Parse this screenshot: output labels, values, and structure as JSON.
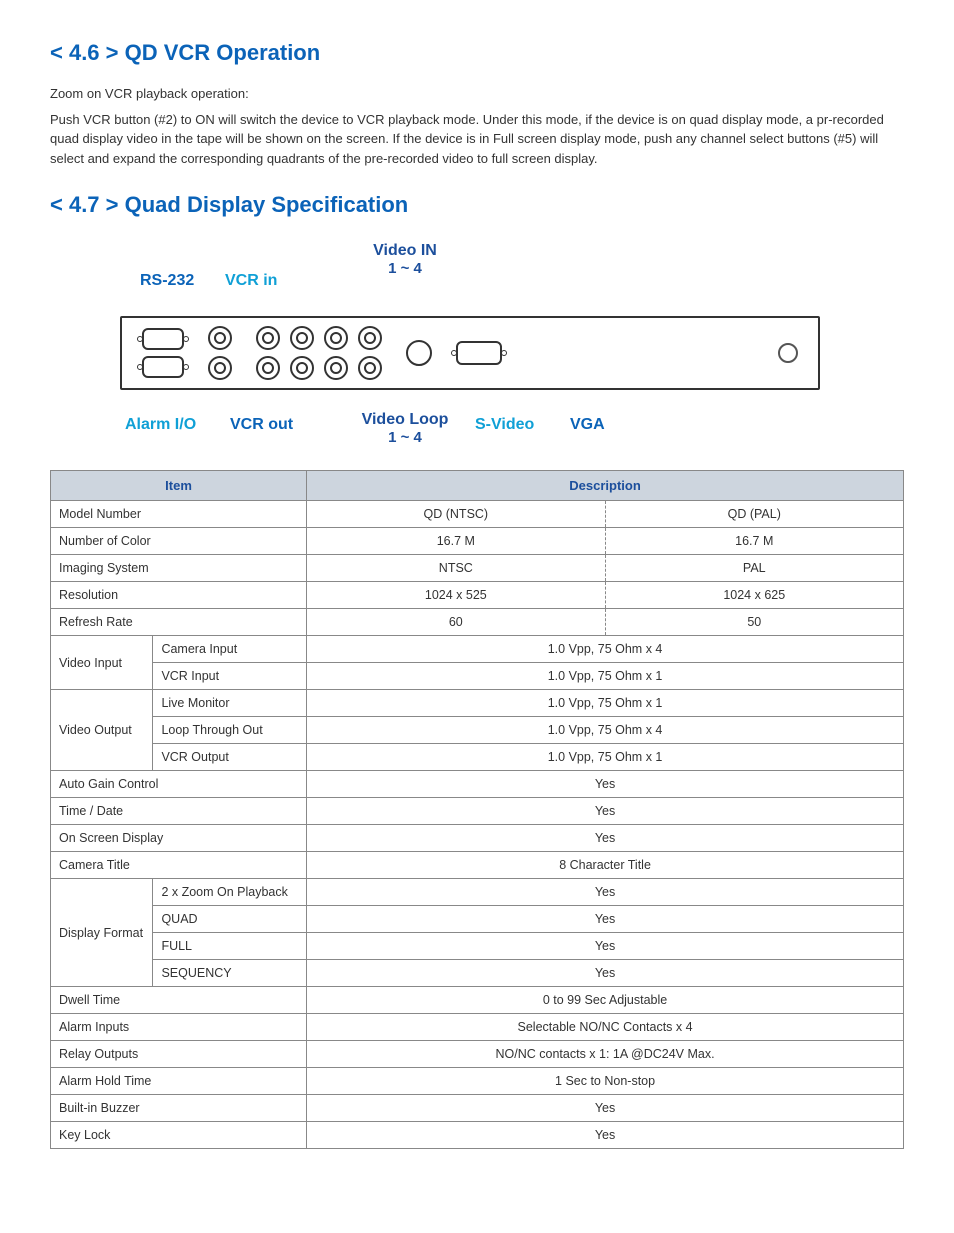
{
  "section46": {
    "title": "< 4.6 > QD  VCR Operation",
    "intro": "Zoom on VCR playback operation:",
    "body": "Push VCR button (#2) to ON will switch the device to VCR playback mode. Under this mode, if the device is on quad display mode, a pr-recorded quad display video in the tape will be shown on the screen. If the device is in Full screen display mode, push any channel select buttons (#5) will select and expand the corresponding quadrants of the pre-recorded video to full screen display."
  },
  "section47": {
    "title": "< 4.7 > Quad Display Specification"
  },
  "diagram": {
    "rs232": "RS-232",
    "vcr_in": "VCR in",
    "video_in": "Video IN",
    "video_in_range": "1 ~ 4",
    "alarm_io": "Alarm I/O",
    "vcr_out": "VCR out",
    "video_loop": "Video Loop",
    "video_loop_range": "1 ~ 4",
    "s_video": "S-Video",
    "vga": "VGA"
  },
  "table": {
    "header_item": "Item",
    "header_desc": "Description",
    "rows": {
      "model_number": {
        "label": "Model Number",
        "ntsc": "QD (NTSC)",
        "pal": "QD (PAL)"
      },
      "num_color": {
        "label": "Number of Color",
        "ntsc": "16.7 M",
        "pal": "16.7 M"
      },
      "imaging": {
        "label": "Imaging System",
        "ntsc": "NTSC",
        "pal": "PAL"
      },
      "resolution": {
        "label": "Resolution",
        "ntsc": "1024 x 525",
        "pal": "1024 x 625"
      },
      "refresh": {
        "label": "Refresh Rate",
        "ntsc": "60",
        "pal": "50"
      },
      "video_input": {
        "label": "Video Input",
        "camera": {
          "label": "Camera Input",
          "value": "1.0 Vpp, 75 Ohm x 4"
        },
        "vcr": {
          "label": "VCR Input",
          "value": "1.0 Vpp, 75 Ohm x 1"
        }
      },
      "video_output": {
        "label": "Video Output",
        "live": {
          "label": "Live Monitor",
          "value": "1.0 Vpp, 75 Ohm x 1"
        },
        "loop": {
          "label": "Loop Through Out",
          "value": "1.0 Vpp, 75 Ohm x 4"
        },
        "vcr": {
          "label": "VCR Output",
          "value": "1.0 Vpp, 75 Ohm x 1"
        }
      },
      "agc": {
        "label": "Auto Gain Control",
        "value": "Yes"
      },
      "time_date": {
        "label": "Time / Date",
        "value": "Yes"
      },
      "osd": {
        "label": "On Screen Display",
        "value": "Yes"
      },
      "cam_title": {
        "label": "Camera Title",
        "value": "8 Character Title"
      },
      "display_fmt": {
        "label": "Display Format",
        "zoom": {
          "label": "2 x Zoom On Playback",
          "value": "Yes"
        },
        "quad": {
          "label": "QUAD",
          "value": "Yes"
        },
        "full": {
          "label": "FULL",
          "value": "Yes"
        },
        "seq": {
          "label": "SEQUENCY",
          "value": "Yes"
        }
      },
      "dwell": {
        "label": "Dwell Time",
        "value": "0 to 99 Sec Adjustable"
      },
      "alarm_in": {
        "label": "Alarm Inputs",
        "value": "Selectable NO/NC Contacts x 4"
      },
      "relay_out": {
        "label": "Relay Outputs",
        "value": "NO/NC contacts x 1: 1A @DC24V Max."
      },
      "alarm_hold": {
        "label": "Alarm Hold Time",
        "value": "1 Sec to Non-stop"
      },
      "buzzer": {
        "label": "Built-in Buzzer",
        "value": "Yes"
      },
      "key_lock": {
        "label": "Key Lock",
        "value": "Yes"
      }
    }
  }
}
